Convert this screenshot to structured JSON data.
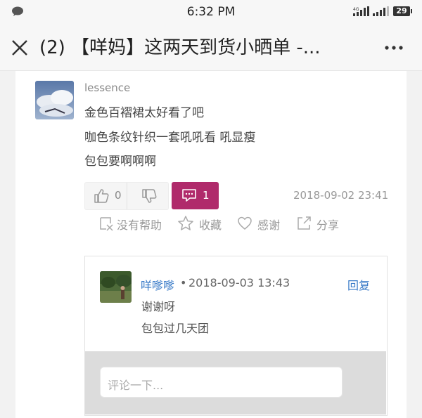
{
  "status_bar": {
    "time": "6:32 PM",
    "network_label": "4G",
    "battery": "29"
  },
  "title_bar": {
    "title": "(2) 【咩妈】这两天到货小晒单 -..."
  },
  "post": {
    "username": "lessence",
    "lines": [
      "金色百褶裙太好看了吧",
      "咖色条纹针织一套吼吼看 吼显瘦",
      "包包要啊啊啊"
    ],
    "upvotes": "0",
    "comments": "1",
    "date": "2018-09-02 23:41",
    "actions": {
      "not_helpful": "没有帮助",
      "favorite": "收藏",
      "thanks": "感谢",
      "share": "分享"
    }
  },
  "reply": {
    "username": "咩嗲嗲",
    "separator": "•",
    "date": "2018-09-03 13:43",
    "reply_label": "回复",
    "lines": [
      "谢谢呀",
      "包包过几天团"
    ],
    "input_placeholder": "评论一下..."
  },
  "colors": {
    "accent": "#b02a6b",
    "link": "#3a7bc8"
  }
}
